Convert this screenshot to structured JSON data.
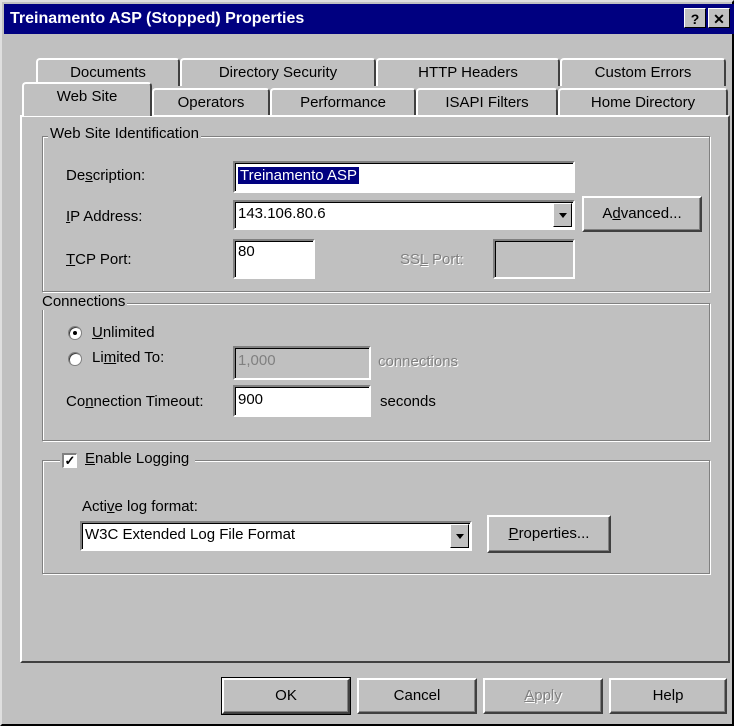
{
  "window": {
    "title": "Treinamento ASP (Stopped) Properties",
    "help_glyph": "?",
    "close_glyph": "✕"
  },
  "tabs": {
    "row1": [
      "Documents",
      "Directory Security",
      "HTTP Headers",
      "Custom Errors"
    ],
    "row2": [
      "Web Site",
      "Operators",
      "Performance",
      "ISAPI Filters",
      "Home Directory"
    ],
    "active": "Web Site"
  },
  "identification": {
    "group_label": "Web Site Identification",
    "description_label": {
      "pre": "De",
      "ul": "s",
      "post": "cription:"
    },
    "description_value": "Treinamento ASP",
    "ip_label": {
      "pre": "",
      "ul": "I",
      "post": "P Address:"
    },
    "ip_value": "143.106.80.6",
    "advanced_button": {
      "pre": "A",
      "ul": "d",
      "post": "vanced..."
    },
    "tcp_label": {
      "pre": "",
      "ul": "T",
      "post": "CP Port:"
    },
    "tcp_value": "80",
    "ssl_label": {
      "pre": "SS",
      "ul": "L",
      "post": " Port:"
    },
    "ssl_value": ""
  },
  "connections": {
    "group_label": "Connections",
    "unlimited_label": {
      "pre": "",
      "ul": "U",
      "post": "nlimited"
    },
    "limited_label": {
      "pre": "Li",
      "ul": "m",
      "post": "ited To:"
    },
    "limited_value": "1,000",
    "limited_unit": "connections",
    "timeout_label": {
      "pre": "Co",
      "ul": "n",
      "post": "nection Timeout:"
    },
    "timeout_value": "900",
    "timeout_unit": "seconds",
    "selected": "Unlimited"
  },
  "logging": {
    "checkbox_label": {
      "pre": "",
      "ul": "E",
      "post": "nable Logging"
    },
    "checked": true,
    "format_label": {
      "pre": "Acti",
      "ul": "v",
      "post": "e log format:"
    },
    "format_value": "W3C Extended Log File Format",
    "properties_button": {
      "pre": "",
      "ul": "P",
      "post": "roperties..."
    }
  },
  "buttons": {
    "ok": "OK",
    "cancel": "Cancel",
    "apply": {
      "pre": "",
      "ul": "A",
      "post": "pply"
    },
    "help": "Help"
  },
  "colors": {
    "title_bar": "#000080",
    "face": "#c0c0c0",
    "selection": "#000080"
  }
}
